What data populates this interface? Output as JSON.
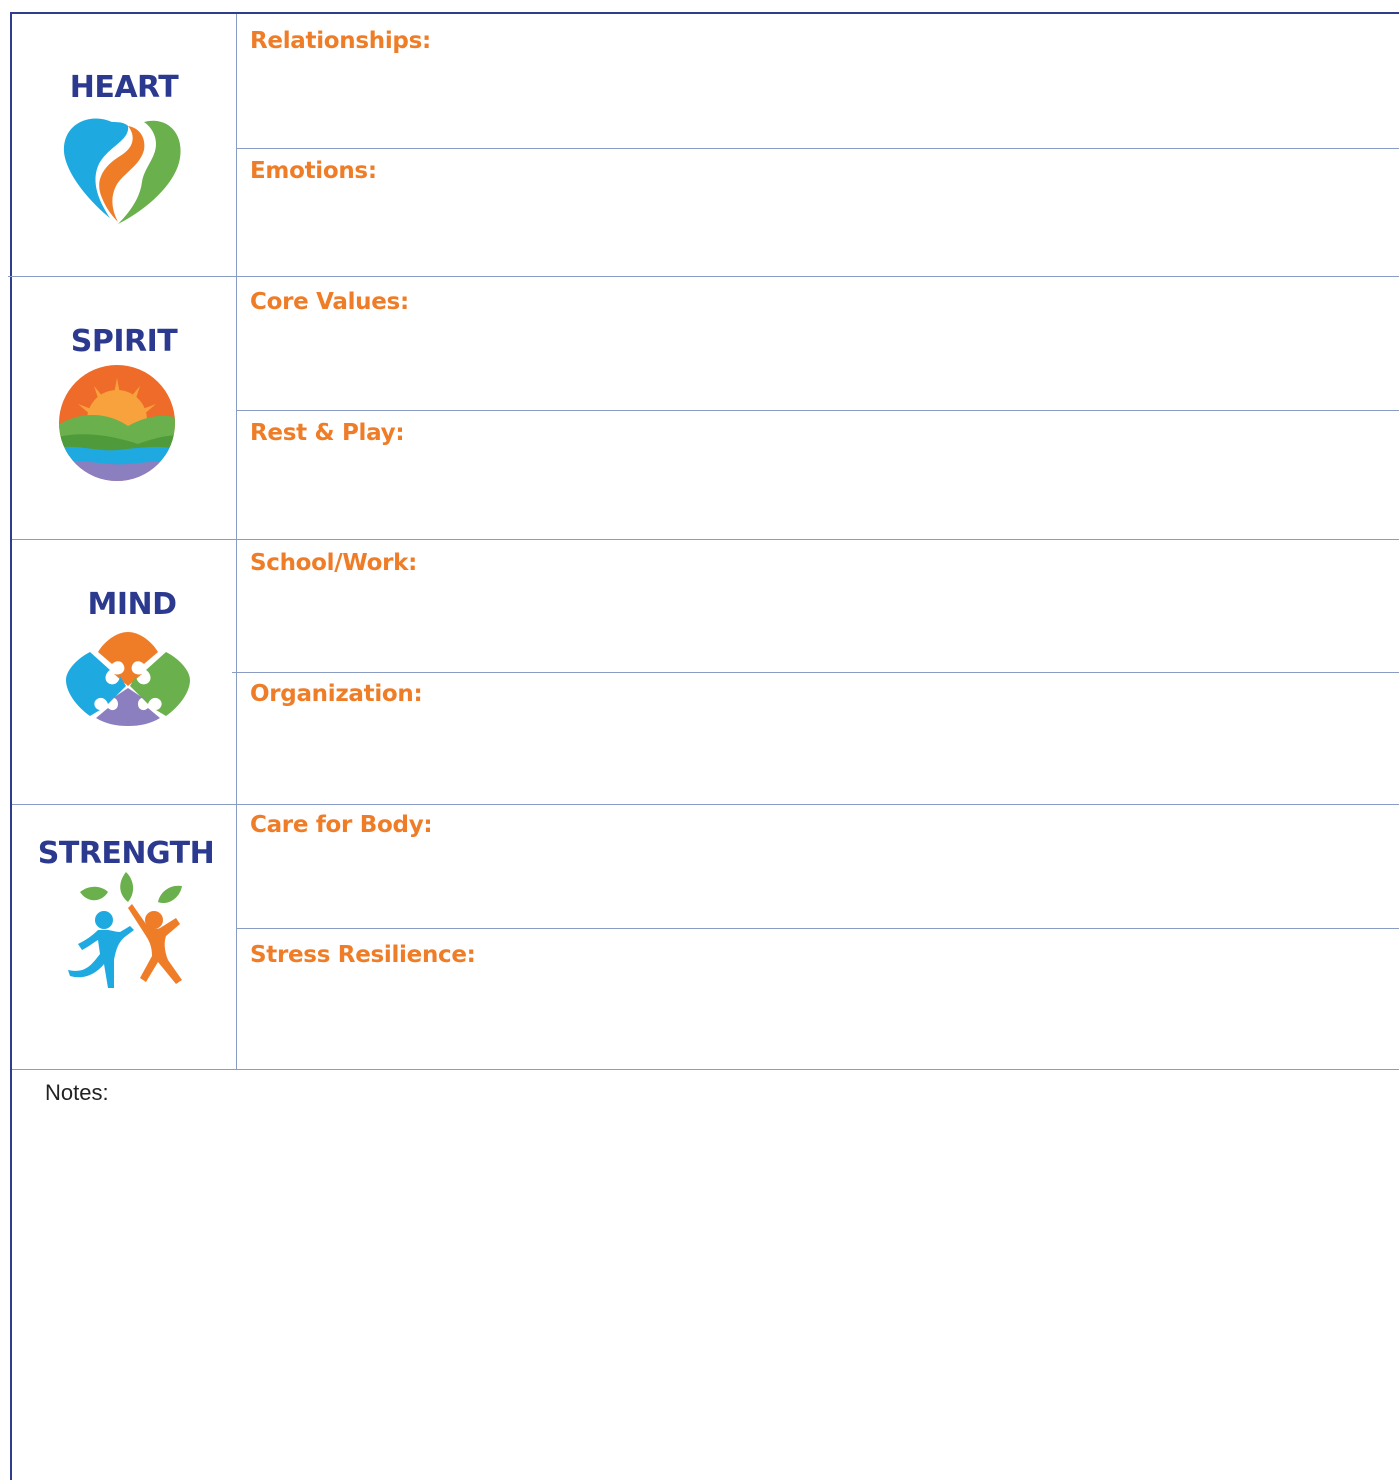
{
  "sections": [
    {
      "title": "HEART",
      "icon": "heart-icon",
      "fields": [
        "Relationships:",
        "Emotions:"
      ]
    },
    {
      "title": "SPIRIT",
      "icon": "sunrise-landscape-icon",
      "fields": [
        "Core Values:",
        "Rest & Play:"
      ]
    },
    {
      "title": "MIND",
      "icon": "puzzle-pieces-icon",
      "fields": [
        "School/Work:",
        "Organization:"
      ]
    },
    {
      "title": "STRENGTH",
      "icon": "people-leaves-icon",
      "fields": [
        "Care for Body:",
        "Stress Resilience:"
      ]
    }
  ],
  "notes": {
    "label": "Notes:"
  },
  "colors": {
    "title": "#2b3a8f",
    "label": "#ef7d28",
    "rule": "#8a9bc4",
    "frame": "#2e3e8c",
    "blue": "#1fa9e1",
    "orange": "#ef7d28",
    "green": "#6ab04c",
    "purple": "#8b7fc0"
  }
}
